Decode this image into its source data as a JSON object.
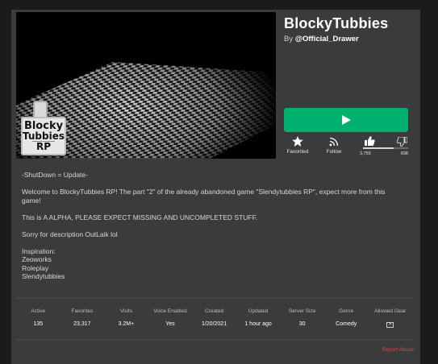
{
  "game": {
    "title": "BlockyTubbies",
    "by_prefix": "By ",
    "creator": "@Official_Drawer"
  },
  "logo": {
    "line1": "Blocky",
    "line2": "Tubbies",
    "line3": "RP"
  },
  "actions": {
    "play_icon": "play-icon",
    "favorited_label": "Favorited",
    "follow_label": "Follow",
    "upvotes": "3,755",
    "downvotes": "838",
    "upvote_ratio": 0.82
  },
  "description": [
    "-ShutDown = Update-",
    "",
    "Welcome to BlockyTubbies RP! The part \"2\" of the already abandoned game \"Slendytubbies RP\", expect more from this game!",
    "",
    "This is A ALPHA, PLEASE EXPECT MISSING AND UNCOMPLETED STUFF.",
    "",
    "Sorry for description OutLaik lol",
    "",
    "Inspiration:",
    "Zeoworks",
    "Roleplay",
    "Slendytubbies"
  ],
  "stats": [
    {
      "label": "Active",
      "value": "135"
    },
    {
      "label": "Favorites",
      "value": "23,317"
    },
    {
      "label": "Visits",
      "value": "3.2M+"
    },
    {
      "label": "Voice Enabled",
      "value": "Yes"
    },
    {
      "label": "Created",
      "value": "1/20/2021"
    },
    {
      "label": "Updated",
      "value": "1 hour ago"
    },
    {
      "label": "Server Size",
      "value": "30"
    },
    {
      "label": "Genre",
      "value": "Comedy"
    },
    {
      "label": "Allowed Gear",
      "value": ""
    }
  ],
  "report_label": "Report Abuse",
  "colors": {
    "play_button": "#00b06f",
    "panel": "#393b3d",
    "report": "#e0453b"
  }
}
